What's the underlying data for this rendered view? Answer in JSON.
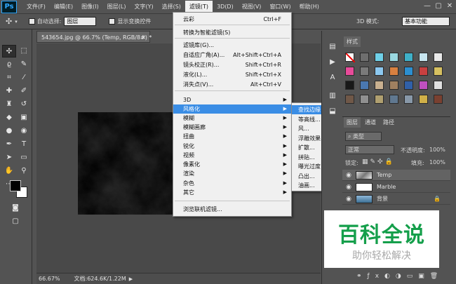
{
  "app": {
    "logo": "Ps"
  },
  "menubar": {
    "items": [
      "文件(F)",
      "编辑(E)",
      "图像(I)",
      "图层(L)",
      "文字(Y)",
      "选择(S)",
      "滤镜(T)",
      "3D(D)",
      "视图(V)",
      "窗口(W)",
      "帮助(H)"
    ],
    "active_index": 6
  },
  "window_controls": {
    "minimize": "—",
    "restore": "▢",
    "close": "✕"
  },
  "options_bar": {
    "auto_select_label": "自动选择:",
    "auto_select_value": "图层",
    "show_transform_label": "显示变换控件",
    "mode_3d_label": "3D 模式:",
    "workspace_value": "基本功能"
  },
  "document": {
    "tab_title": "543654.jpg @ 66.7% (Temp, RGB/8#) *",
    "zoom": "66.67%",
    "doc_info": "文档:624.6K/1.22M"
  },
  "filter_menu": {
    "items": [
      {
        "label": "云彩",
        "shortcut": "Ctrl+F"
      },
      {
        "label": "转换为智能滤镜(S)",
        "shortcut": ""
      },
      {
        "label": "滤镜库(G)...",
        "shortcut": ""
      },
      {
        "label": "自适应广角(A)...",
        "shortcut": "Alt+Shift+Ctrl+A"
      },
      {
        "label": "镜头校正(R)...",
        "shortcut": "Shift+Ctrl+R"
      },
      {
        "label": "液化(L)...",
        "shortcut": "Shift+Ctrl+X"
      },
      {
        "label": "消失点(V)...",
        "shortcut": "Alt+Ctrl+V"
      },
      {
        "label": "3D",
        "shortcut": ""
      },
      {
        "label": "风格化",
        "shortcut": ""
      },
      {
        "label": "模糊",
        "shortcut": ""
      },
      {
        "label": "模糊画廊",
        "shortcut": ""
      },
      {
        "label": "扭曲",
        "shortcut": ""
      },
      {
        "label": "锐化",
        "shortcut": ""
      },
      {
        "label": "视频",
        "shortcut": ""
      },
      {
        "label": "像素化",
        "shortcut": ""
      },
      {
        "label": "渲染",
        "shortcut": ""
      },
      {
        "label": "杂色",
        "shortcut": ""
      },
      {
        "label": "其它",
        "shortcut": ""
      },
      {
        "label": "浏览联机滤镜...",
        "shortcut": ""
      }
    ]
  },
  "stylize_submenu": {
    "items": [
      "查找边缘",
      "等高线...",
      "风...",
      "浮雕效果...",
      "扩散...",
      "拼贴...",
      "曝光过度",
      "凸出...",
      "油画..."
    ],
    "highlighted_index": 0
  },
  "styles_panel": {
    "title": "样式"
  },
  "layers_panel": {
    "tabs": [
      "图层",
      "通道",
      "路径"
    ],
    "kind_label": "类型",
    "blend_mode": "正常",
    "opacity_label": "不透明度:",
    "opacity_value": "100%",
    "lock_label": "锁定:",
    "fill_label": "填充:",
    "fill_value": "100%",
    "layers": [
      {
        "name": "Temp",
        "active": true
      },
      {
        "name": "Marble",
        "active": false
      },
      {
        "name": "背景",
        "active": false
      }
    ]
  },
  "watermark": {
    "title": "百科全说",
    "subtitle": "助你轻松解决"
  },
  "colors": {
    "menu_highlight": "#3a8de5",
    "watermark_green": "#159f4b",
    "ui_dark": "#535353"
  }
}
